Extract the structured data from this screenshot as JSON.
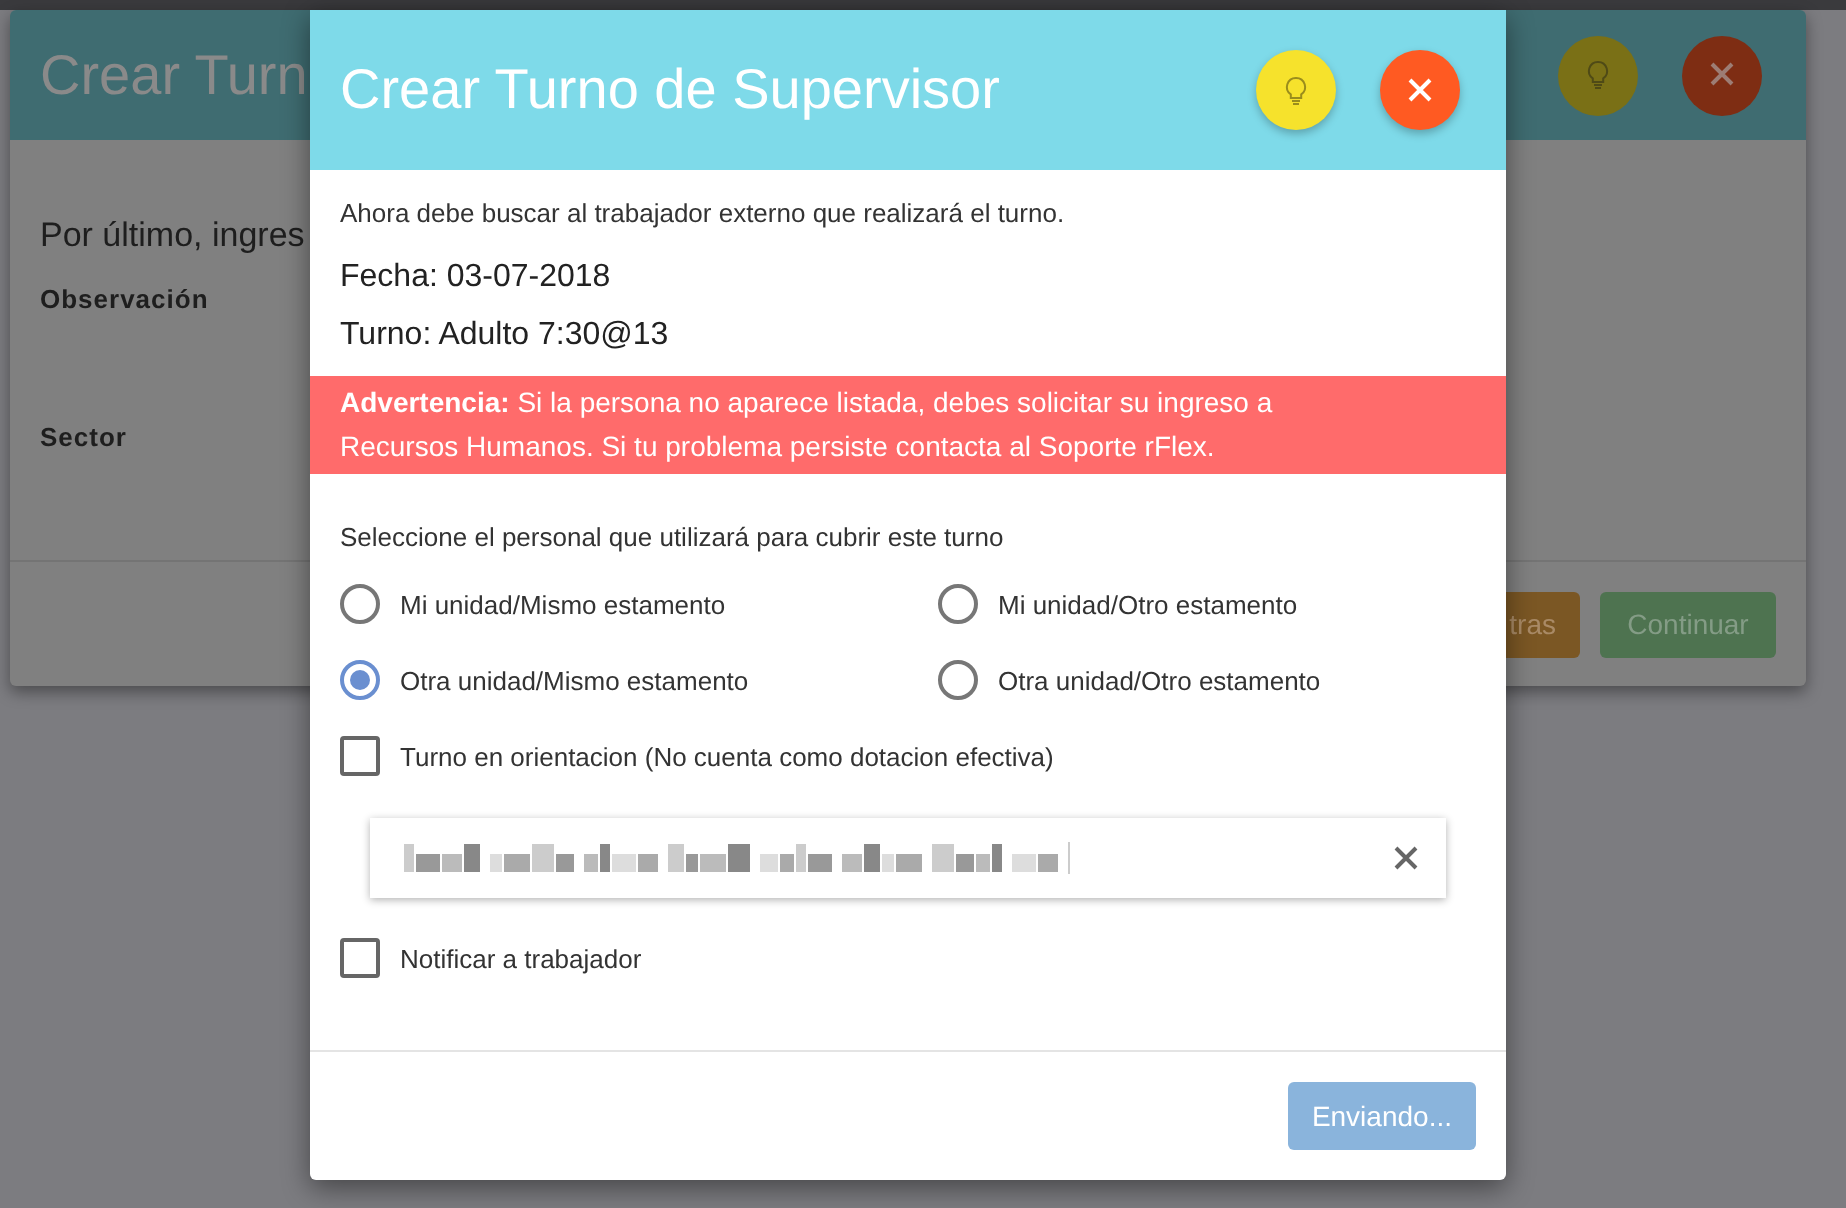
{
  "background_dialog": {
    "title": "Crear Turn",
    "prompt": "Por último, ingres",
    "fields": [
      {
        "label": "Observación"
      },
      {
        "label": "Sector"
      }
    ],
    "buttons": [
      {
        "label": "tras",
        "kind": "warning"
      },
      {
        "label": "Continuar",
        "kind": "success"
      }
    ]
  },
  "dialog": {
    "title": "Crear Turno de Supervisor",
    "intro": "Ahora debe buscar al trabajador externo que realizará el turno.",
    "date": "Fecha: 03-07-2018",
    "shift": "Turno: Adulto 7:30@13",
    "warning": "**Advertencia:** Si la persona no aparece listada, debes solicitar su ingreso a Recursos Humanos. Si tu problema persiste contacta al Soporte rFlex.",
    "select_label": "Seleccione el personal que utilizará para cubrir este turno",
    "options": [
      {
        "label": "Mi unidad/Mismo estamento",
        "selected": false
      },
      {
        "label": "Mi unidad/Otro estamento",
        "selected": false
      },
      {
        "label": "Otra unidad/Mismo estamento",
        "selected": true
      },
      {
        "label": "Otra unidad/Otro estamento",
        "selected": false
      }
    ],
    "orientation": {
      "label": "Turno en orientacion (No cuenta como dotacion efectiva)",
      "checked": false
    },
    "notify": {
      "label": "Notificar a trabajador",
      "checked": false
    },
    "submit": {
      "label": "Enviando...",
      "disabled": true
    }
  }
}
